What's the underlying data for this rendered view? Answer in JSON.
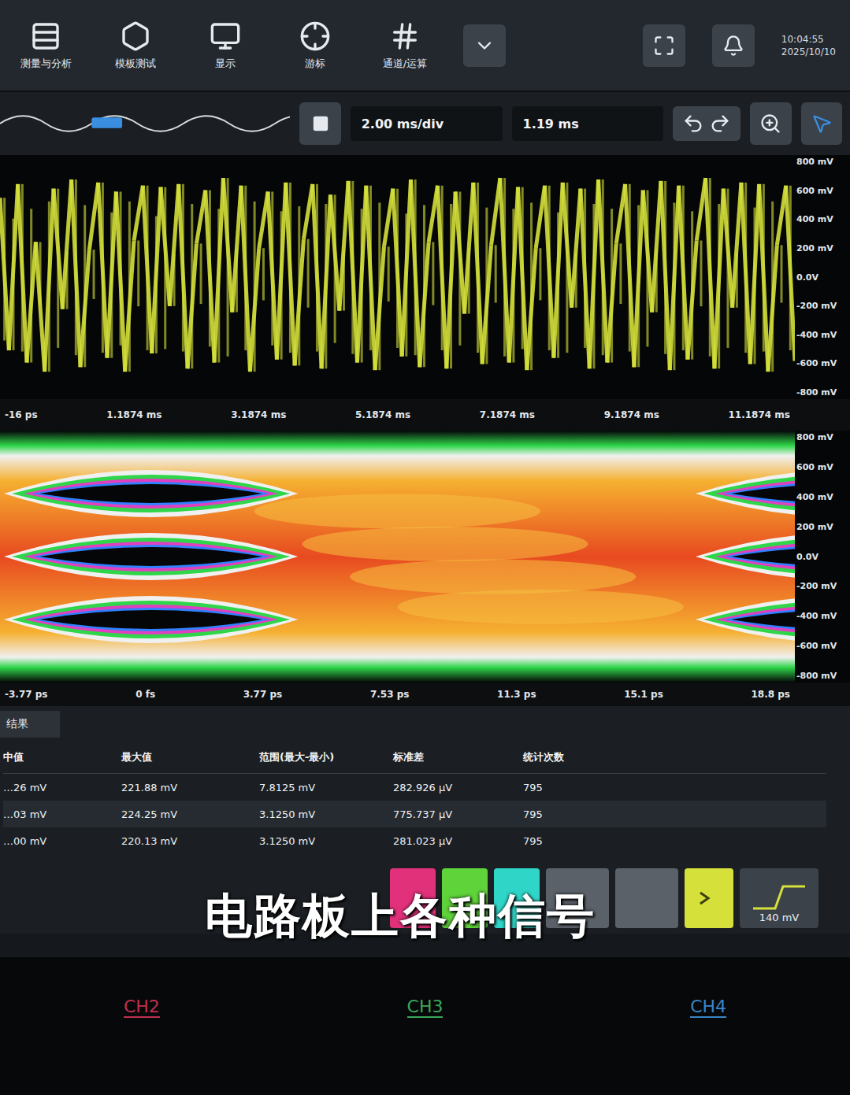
{
  "toolbar": [
    {
      "label": "测量与分析"
    },
    {
      "label": "模板测试"
    },
    {
      "label": "显示"
    },
    {
      "label": "游标"
    },
    {
      "label": "通道/运算"
    }
  ],
  "clock": {
    "time": "10:04:55",
    "date": "2025/10/10"
  },
  "acquisition": {
    "running": false,
    "timebase": "2.00 ms/div",
    "delay": "1.19 ms"
  },
  "waveform": {
    "color": "#d4e03a",
    "y_ticks": [
      "800 mV",
      "600 mV",
      "400 mV",
      "200 mV",
      "0.0V",
      "-200 mV",
      "-400 mV",
      "-600 mV",
      "-800 mV"
    ],
    "x_ticks": [
      "-16 ps",
      "1.1874 ms",
      "3.1874 ms",
      "5.1874 ms",
      "7.1874 ms",
      "9.1874 ms",
      "11.1874 ms"
    ],
    "values": [
      520,
      -480,
      610,
      -560,
      230,
      -620,
      580,
      -210,
      640,
      -590,
      180,
      620,
      -530,
      560,
      -620,
      240,
      600,
      -500,
      590,
      -190,
      610,
      -600,
      220,
      570,
      -560,
      650,
      -230,
      600,
      -620,
      190,
      560,
      -540,
      620,
      -580,
      250,
      610,
      -600,
      540,
      -220,
      630,
      -560,
      600,
      -610,
      200,
      580,
      -520,
      640,
      -590,
      230,
      600,
      -600,
      560,
      -240,
      620,
      -570,
      210,
      650,
      -560,
      590,
      -610,
      190,
      600,
      -530,
      620,
      -200,
      580,
      -600,
      640,
      -560,
      220,
      610,
      -590,
      570,
      -230,
      630,
      -610,
      600,
      -540,
      240,
      650,
      -600,
      580,
      -200,
      620,
      -570,
      610,
      -620,
      210,
      600,
      -550
    ]
  },
  "eye": {
    "y_ticks": [
      "800 mV",
      "600 mV",
      "400 mV",
      "200 mV",
      "0.0V",
      "-200 mV",
      "-400 mV",
      "-600 mV",
      "-800 mV"
    ],
    "x_ticks": [
      "-3.77 ps",
      "0 fs",
      "3.77 ps",
      "7.53 ps",
      "11.3 ps",
      "15.1 ps",
      "18.8 ps"
    ],
    "eye_centers": [
      400,
      0,
      -400
    ]
  },
  "results": {
    "tab": "结果",
    "columns": [
      "中值",
      "最大值",
      "范围(最大-最小)",
      "标准差",
      "统计次数"
    ],
    "rows": [
      [
        "…26 mV",
        "221.88 mV",
        "7.8125 mV",
        "282.926 µV",
        "795"
      ],
      [
        "…03 mV",
        "224.25 mV",
        "3.1250 mV",
        "775.737 µV",
        "795"
      ],
      [
        "…00 mV",
        "220.13 mV",
        "3.1250 mV",
        "281.023 µV",
        "795"
      ]
    ]
  },
  "channel_buttons": [
    {
      "color": "#e0317a"
    },
    {
      "color": "#5fd33a"
    },
    {
      "color": "#2fd6c8"
    }
  ],
  "trigger": {
    "level": "140 mV"
  },
  "bezel_channels": [
    {
      "label": "CH2",
      "color": "#c0304f"
    },
    {
      "label": "CH3",
      "color": "#3aa85a"
    },
    {
      "label": "CH4",
      "color": "#3a86c8"
    }
  ],
  "caption": "电路板上各种信号"
}
